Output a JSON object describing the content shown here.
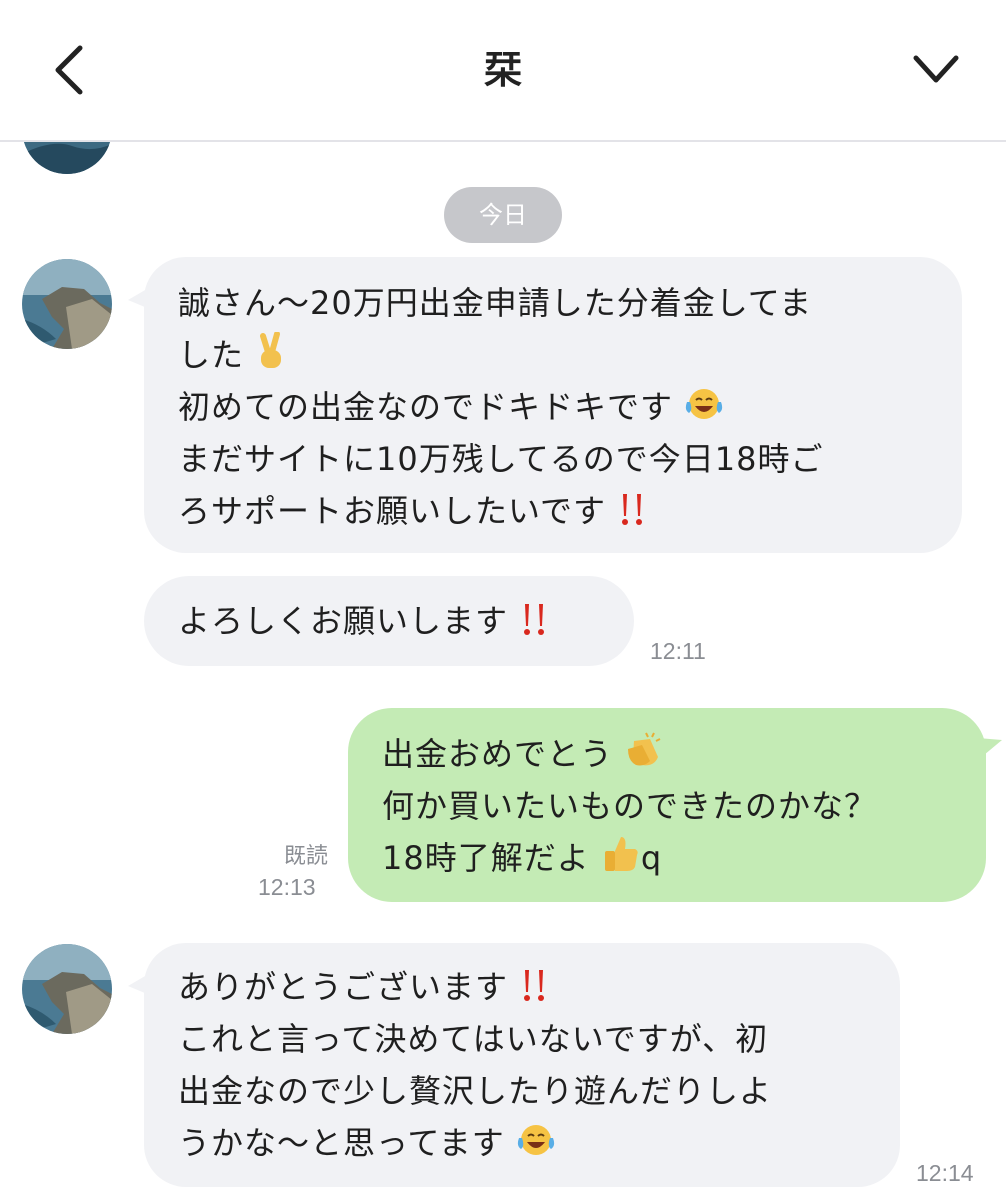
{
  "header": {
    "title": "栞",
    "back_icon": "chevron-left-icon",
    "menu_icon": "chevron-down-icon"
  },
  "date_divider": "今日",
  "messages": [
    {
      "side": "in",
      "lines": [
        "誠さん〜20万円出金申請した分着金してま",
        "した",
        "初めての出金なのでドキドキです",
        "まだサイトに10万残してるので今日18時ご",
        "ろサポートお願いしたいです"
      ],
      "emojis": [
        "",
        "victory-hand-emoji",
        "tears-of-joy-emoji",
        "",
        "double-exclamation-emoji"
      ]
    },
    {
      "side": "in",
      "lines": [
        "よろしくお願いします"
      ],
      "emojis": [
        "double-exclamation-emoji"
      ],
      "time": "12:11"
    },
    {
      "side": "out",
      "lines": [
        "出金おめでとう",
        "何か買いたいものできたのかな？",
        "18時了解だよ"
      ],
      "emojis": [
        "clapping-hands-emoji",
        "",
        "thumbs-up-emoji"
      ],
      "line3_suffix": "q",
      "read": "既読",
      "time": "12:13"
    },
    {
      "side": "in",
      "lines": [
        "ありがとうございます",
        "これと言って決めてはいないですが、初",
        "出金なので少し贅沢したり遊んだりしよ",
        "うかな〜と思ってます"
      ],
      "emojis": [
        "double-exclamation-emoji",
        "",
        "",
        "tears-of-joy-emoji"
      ],
      "time": "12:14"
    }
  ],
  "colors": {
    "incoming_bubble": "#f1f2f5",
    "outgoing_bubble": "#c4ebb5",
    "date_pill": "#c6c7cb",
    "meta_text": "#8a8d93"
  }
}
